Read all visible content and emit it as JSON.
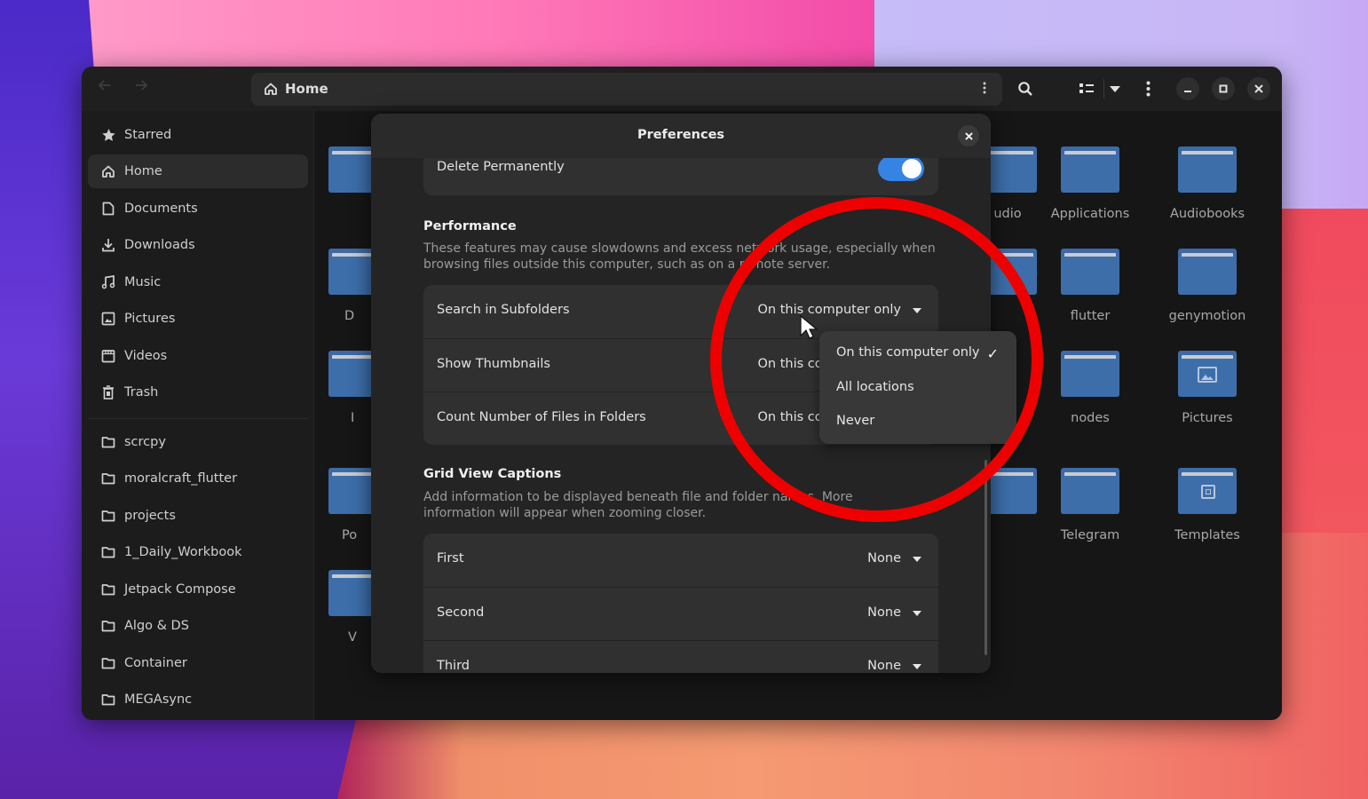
{
  "window": {
    "location_label": "Home",
    "nav": {
      "back_icon": "arrow-left",
      "forward_icon": "arrow-right"
    },
    "toolbar": {
      "location_menu_icon": "kebab-vertical",
      "search_icon": "search",
      "view_icon": "list-view",
      "view_dropdown_icon": "caret-down",
      "main_menu_icon": "kebab-vertical",
      "minimize_icon": "minimize",
      "maximize_icon": "maximize",
      "close_icon": "close"
    }
  },
  "sidebar": {
    "places": [
      {
        "label": "Starred",
        "icon": "star"
      },
      {
        "label": "Home",
        "icon": "home",
        "active": true
      },
      {
        "label": "Documents",
        "icon": "document"
      },
      {
        "label": "Downloads",
        "icon": "download"
      },
      {
        "label": "Music",
        "icon": "music"
      },
      {
        "label": "Pictures",
        "icon": "picture"
      },
      {
        "label": "Videos",
        "icon": "video"
      },
      {
        "label": "Trash",
        "icon": "trash"
      }
    ],
    "bookmarks": [
      {
        "label": "scrcpy",
        "icon": "folder"
      },
      {
        "label": "moralcraft_flutter",
        "icon": "folder"
      },
      {
        "label": "projects",
        "icon": "folder"
      },
      {
        "label": "1_Daily_Workbook",
        "icon": "folder"
      },
      {
        "label": "Jetpack Compose",
        "icon": "folder"
      },
      {
        "label": "Algo & DS",
        "icon": "folder"
      },
      {
        "label": "Container",
        "icon": "folder"
      },
      {
        "label": "MEGAsync",
        "icon": "folder"
      }
    ]
  },
  "content": {
    "partial_left_labels": [
      "D",
      "I",
      "Po",
      "V"
    ],
    "partial_label_udio": "udio",
    "folders": [
      {
        "name": "Applications",
        "emblem": ""
      },
      {
        "name": "Audiobooks",
        "emblem": ""
      },
      {
        "name": "flutter",
        "emblem": ""
      },
      {
        "name": "genymotion",
        "emblem": ""
      },
      {
        "name": "nodes",
        "emblem": ""
      },
      {
        "name": "Pictures",
        "emblem": "picture"
      },
      {
        "name": "Telegram",
        "emblem": ""
      },
      {
        "name": "Templates",
        "emblem": "template"
      }
    ]
  },
  "preferences": {
    "title": "Preferences",
    "close_icon": "close",
    "delete_permanently": {
      "label": "Delete Permanently",
      "enabled": true
    },
    "performance": {
      "title": "Performance",
      "description": "These features may cause slowdowns and excess network usage, especially when browsing files outside this computer, such as on a remote server.",
      "rows": [
        {
          "label": "Search in Subfolders",
          "value": "On this computer only"
        },
        {
          "label": "Show Thumbnails",
          "value": "On this computer only"
        },
        {
          "label": "Count Number of Files in Folders",
          "value": "On this computer only"
        }
      ]
    },
    "grid_view_captions": {
      "title": "Grid View Captions",
      "description": "Add information to be displayed beneath file and folder names. More information will appear when zooming closer.",
      "rows": [
        {
          "label": "First",
          "value": "None"
        },
        {
          "label": "Second",
          "value": "None"
        },
        {
          "label": "Third",
          "value": "None"
        }
      ]
    },
    "dropdown_popover": {
      "options": [
        "On this computer only",
        "All locations",
        "Never"
      ],
      "selected": "On this computer only",
      "check_glyph": "✓"
    }
  },
  "colors": {
    "accent": "#3584e4",
    "folder": "#3d6aa6",
    "annotation": "#ee0000",
    "dialog_bg": "#242424",
    "row_bg": "#303030"
  }
}
